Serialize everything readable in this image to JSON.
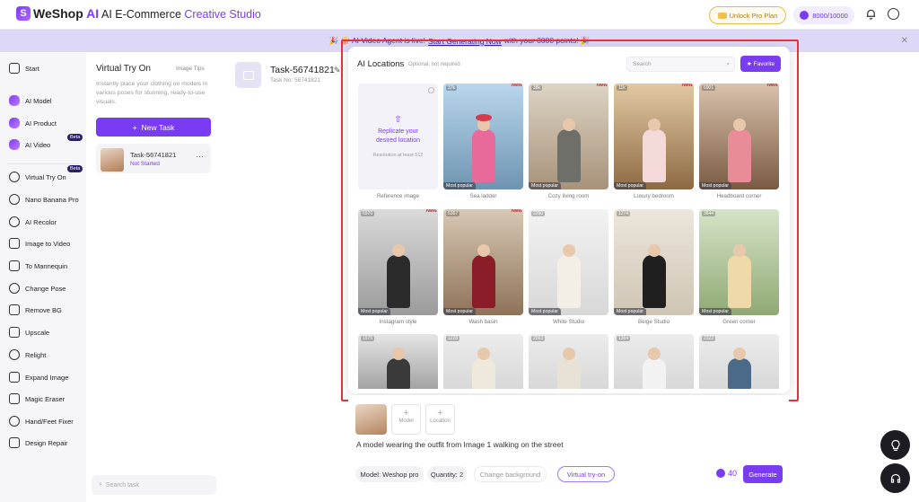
{
  "header": {
    "logo_mark": "S",
    "logo_we": "WeShop",
    "logo_ai": " AI",
    "studio_prefix": "AI E-Commerce ",
    "studio_accent": "Creative Studio",
    "unlock_label": "Unlock Pro Plan",
    "points": "8000/10000",
    "bell_icon": "bell-icon",
    "user_icon": "user-circle-icon"
  },
  "announcement": {
    "prefix": "🎉 🍿 AI Video Agent is live! ",
    "link": "Start Generating Now",
    "suffix": " with your 3000 points! 🎉",
    "close": "✕"
  },
  "sidebar": {
    "start": "Start",
    "items": [
      {
        "label": "AI Model",
        "icon": "model-icon"
      },
      {
        "label": "AI Product",
        "icon": "product-icon"
      },
      {
        "label": "AI Video",
        "icon": "video-icon",
        "badge": "Beta"
      },
      {
        "label": "Virtual Try On",
        "icon": "try-on-icon",
        "badge": "Beta"
      },
      {
        "label": "Nano Banana Pro",
        "icon": "banana-icon"
      },
      {
        "label": "AI Recolor",
        "icon": "palette-icon"
      },
      {
        "label": "Image to Video",
        "icon": "image-video-icon"
      },
      {
        "label": "To Mannequin",
        "icon": "mannequin-icon"
      },
      {
        "label": "Change Pose",
        "icon": "pose-icon"
      },
      {
        "label": "Remove BG",
        "icon": "remove-bg-icon"
      },
      {
        "label": "Upscale",
        "icon": "upscale-icon"
      },
      {
        "label": "Relight",
        "icon": "relight-icon"
      },
      {
        "label": "Expand Image",
        "icon": "expand-icon"
      },
      {
        "label": "Magic Eraser",
        "icon": "eraser-icon"
      },
      {
        "label": "Hand/Feet Fixer",
        "icon": "hand-icon"
      },
      {
        "label": "Design Repair",
        "icon": "repair-icon"
      }
    ]
  },
  "tasks": {
    "title": "Virtual Try On",
    "image_tips": "Image Tips",
    "description": "Instantly place your clothing on models in various poses for stunning, ready-to-use visuals.",
    "new_task": "New Task",
    "card": {
      "name": "Task-56741821",
      "status": "Not Started",
      "more": "···"
    },
    "search_placeholder": "Search task"
  },
  "main": {
    "task_title": "Task-56741821",
    "task_no": "Task No: 56741821"
  },
  "locations": {
    "title": "AI Locations",
    "subtitle": "Optional, not required",
    "search_placeholder": "Search",
    "favorite": "Favorite",
    "reference": {
      "line1": "Replicate your",
      "line2": "desired location",
      "resolution": "Resolution at least 512",
      "caption": "Reference image"
    },
    "row1": [
      {
        "caption": "Sea ladder",
        "views": "37k",
        "new": "New",
        "popular": "Most popular",
        "bg1": "#b9d7ee",
        "bg2": "#6f94b0",
        "outfit": "#e86a9a",
        "hat": "#d63a4a"
      },
      {
        "caption": "Cozy living room",
        "views": "38k",
        "new": "New",
        "popular": "Most popular",
        "bg1": "#ddd4c5",
        "bg2": "#a7927a",
        "outfit": "#6f6f6a",
        "hat": ""
      },
      {
        "caption": "Luxury bedroom",
        "views": "11k",
        "new": "New",
        "popular": "Most popular",
        "bg1": "#e2c9a2",
        "bg2": "#8d6a44",
        "outfit": "#f4d9d9",
        "hat": ""
      },
      {
        "caption": "Headboard corner",
        "views": "6901",
        "new": "New",
        "popular": "Most popular",
        "bg1": "#d9c2ad",
        "bg2": "#7a5a42",
        "outfit": "#e88c98",
        "hat": ""
      }
    ],
    "row2": [
      {
        "caption": "Instagram style",
        "views": "6970",
        "new": "New",
        "popular": "Most popular",
        "bg1": "#dadada",
        "bg2": "#9b9b9b",
        "outfit": "#2b2b2b",
        "hat": ""
      },
      {
        "caption": "Wash basin",
        "views": "6367",
        "new": "New",
        "popular": "Most popular",
        "bg1": "#d7c8b4",
        "bg2": "#8e7258",
        "outfit": "#8a1d27",
        "hat": ""
      },
      {
        "caption": "White Studio",
        "views": "2390",
        "new": "",
        "popular": "Most popular",
        "bg1": "#f2f2f2",
        "bg2": "#d8d8d8",
        "outfit": "#f4efe6",
        "hat": ""
      },
      {
        "caption": "Beige Studio",
        "views": "1274",
        "new": "",
        "popular": "Most popular",
        "bg1": "#ece6dc",
        "bg2": "#cfc5b4",
        "outfit": "#1f1f1f",
        "hat": ""
      },
      {
        "caption": "Green corner",
        "views": "3844",
        "new": "",
        "popular": "Most popular",
        "bg1": "#d6e4c8",
        "bg2": "#8fa974",
        "outfit": "#f0d9a8",
        "hat": ""
      }
    ],
    "row3": [
      {
        "views": "1575",
        "bg1": "#e5e5e5",
        "bg2": "#9a9a9a",
        "outfit": "#3a3a3a"
      },
      {
        "views": "1228",
        "bg1": "#ececec",
        "bg2": "#d5d5d5",
        "outfit": "#efe8dc"
      },
      {
        "views": "2093",
        "bg1": "#ececec",
        "bg2": "#d5d5d5",
        "outfit": "#e8e2d6"
      },
      {
        "views": "1364",
        "bg1": "#ececec",
        "bg2": "#d5d5d5",
        "outfit": "#f2f2f2"
      },
      {
        "views": "2322",
        "bg1": "#ececec",
        "bg2": "#d5d5d5",
        "outfit": "#4b6a8a"
      }
    ]
  },
  "composer": {
    "model_slot": "Model",
    "location_slot": "Location",
    "prompt": "A model wearing the outfit from Image 1 walking on the street",
    "model_chip": "Model: Weshop pro",
    "quantity_chip": "Quantity: 2",
    "change_bg": "Change background",
    "virtual_try_on": "Virtual try-on",
    "cost": "40",
    "generate": "Generate"
  },
  "fabs": {
    "tips": "tips-lightbulb-icon",
    "support": "headset-support-icon"
  },
  "colors": {
    "accent": "#7a3cf2",
    "highlight": "#e0353a",
    "new_badge": "#e0202a"
  }
}
